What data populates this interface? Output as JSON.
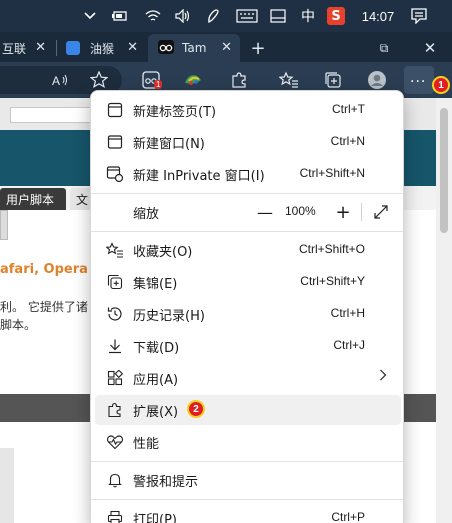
{
  "taskbar": {
    "tray_icons": [
      "chevron-up-icon",
      "battery-icon",
      "wifi-icon",
      "volume-icon",
      "pen-icon",
      "keyboard-icon",
      "window-icon"
    ],
    "ime_mode": "中",
    "ime_logo": "S",
    "clock": "14:07",
    "notification_icon": "notification-icon"
  },
  "tabs": [
    {
      "label": "互联",
      "favicon_color": "#ffffff"
    },
    {
      "label": "油猴",
      "favicon_color": "#3a86e8"
    },
    {
      "label": "Tam",
      "favicon_color": "#000000"
    }
  ],
  "new_tab_label": "+",
  "window_controls": {
    "restore": "⧉",
    "close": "✕"
  },
  "toolbar": {
    "badge_count": "1",
    "marker_1": "1"
  },
  "page": {
    "nav_tab_1": "用户脚本",
    "nav_tab_2": "文",
    "orange_heading": "afari, Opera Ne",
    "text_line_1": "利。 它提供了诸",
    "text_line_2": "脚本。"
  },
  "menu": {
    "items": [
      {
        "label": "新建标签页(T)",
        "shortcut": "Ctrl+T"
      },
      {
        "label": "新建窗口(N)",
        "shortcut": "Ctrl+N"
      },
      {
        "label": "新建 InPrivate 窗口(I)",
        "shortcut": "Ctrl+Shift+N"
      },
      {
        "label": "缩放",
        "shortcut": ""
      },
      {
        "label": "收藏夹(O)",
        "shortcut": "Ctrl+Shift+O"
      },
      {
        "label": "集锦(E)",
        "shortcut": "Ctrl+Shift+Y"
      },
      {
        "label": "历史记录(H)",
        "shortcut": "Ctrl+H"
      },
      {
        "label": "下载(D)",
        "shortcut": "Ctrl+J"
      },
      {
        "label": "应用(A)",
        "shortcut": ""
      },
      {
        "label": "扩展(X)",
        "shortcut": ""
      },
      {
        "label": "性能",
        "shortcut": ""
      },
      {
        "label": "警报和提示",
        "shortcut": ""
      },
      {
        "label": "打印(P)",
        "shortcut": "Ctrl+P"
      }
    ],
    "zoom": {
      "minus": "—",
      "value": "100%",
      "plus": "+"
    },
    "marker_2": "2"
  },
  "colors": {
    "taskbar_bg": "#1f3044",
    "toolbar_bg": "#2b3d52",
    "marker_red": "#e02020",
    "marker_ring": "#f5d020",
    "page_teal": "#16556a",
    "page_orange": "#e0822a"
  }
}
